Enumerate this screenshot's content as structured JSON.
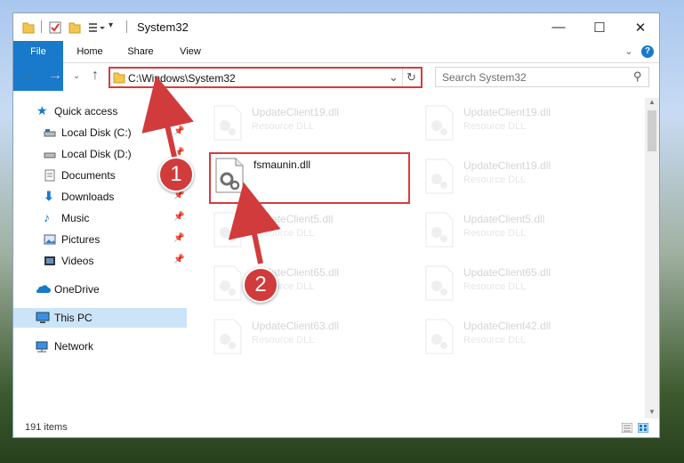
{
  "window": {
    "title": "System32",
    "tabs": {
      "file": "File",
      "home": "Home",
      "share": "Share",
      "view": "View"
    },
    "address": "C:\\Windows\\System32",
    "search_placeholder": "Search System32"
  },
  "sidebar": {
    "items": [
      {
        "label": "Quick access"
      },
      {
        "label": "Local Disk (C:)"
      },
      {
        "label": "Local Disk (D:)"
      },
      {
        "label": "Documents"
      },
      {
        "label": "Downloads"
      },
      {
        "label": "Music"
      },
      {
        "label": "Pictures"
      },
      {
        "label": "Videos"
      },
      {
        "label": "OneDrive"
      },
      {
        "label": "This PC"
      },
      {
        "label": "Network"
      }
    ]
  },
  "files": [
    {
      "name": "UpdateClient19.dll",
      "type": "Resource DLL"
    },
    {
      "name": "UpdateClient19.dll",
      "type": "Resource DLL"
    },
    {
      "name": "fsmaunin.dll",
      "type": ""
    },
    {
      "name": "UpdateClient19.dll",
      "type": "Resource DLL"
    },
    {
      "name": "UpdateClient5.dll",
      "type": "Resource DLL"
    },
    {
      "name": "UpdateClient5.dll",
      "type": "Resource DLL"
    },
    {
      "name": "UpdateClient65.dll",
      "type": "Resource DLL"
    },
    {
      "name": "UpdateClient65.dll",
      "type": "Resource DLL"
    },
    {
      "name": "UpdateClient63.dll",
      "type": "Resource DLL"
    },
    {
      "name": "UpdateClient42.dll",
      "type": "Resource DLL"
    }
  ],
  "status": {
    "count": "191 items"
  },
  "callouts": {
    "one": "1",
    "two": "2"
  },
  "colors": {
    "accent": "#1979ca",
    "highlight": "#d93a3a",
    "selected": "#cce4f7"
  }
}
